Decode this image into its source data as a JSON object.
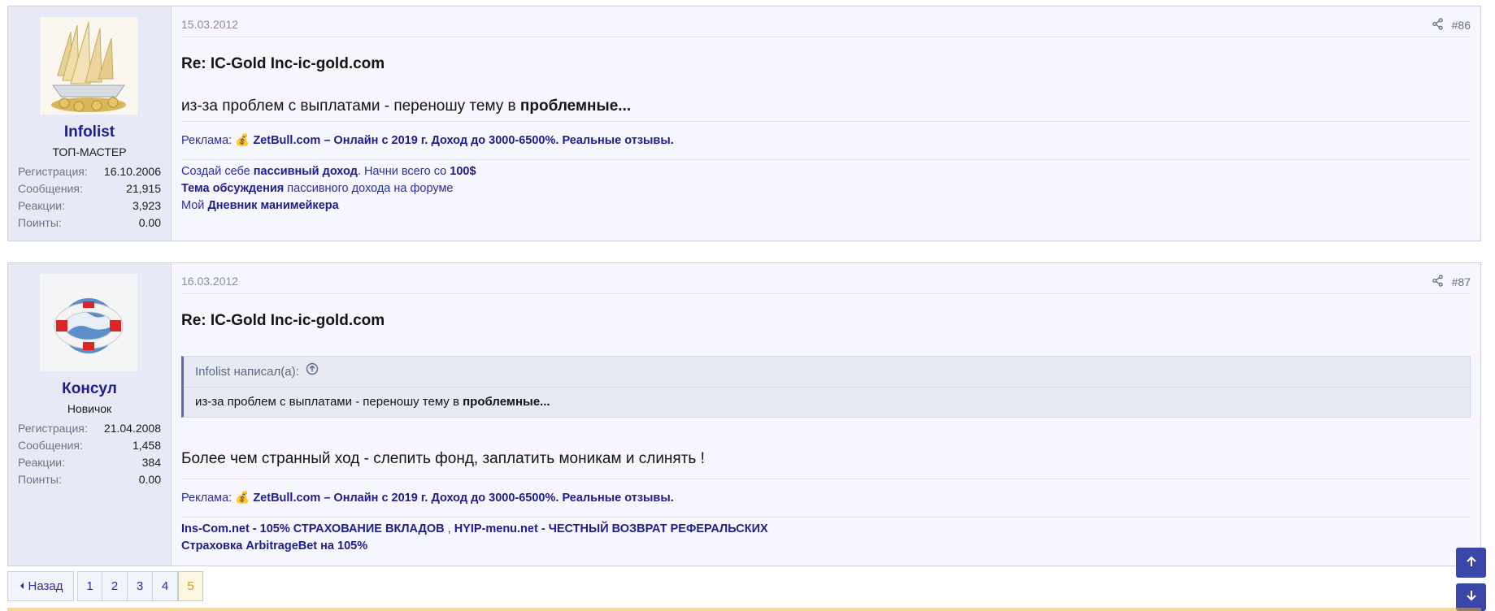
{
  "posts": [
    {
      "date": "15.03.2012",
      "number": "#86",
      "user": {
        "name": "Infolist",
        "title": "ТОП-МАСТЕР",
        "stats": [
          {
            "k": "Регистрация:",
            "v": "16.10.2006"
          },
          {
            "k": "Сообщения:",
            "v": "21,915"
          },
          {
            "k": "Реакции:",
            "v": "3,923"
          },
          {
            "k": "Поинты:",
            "v": "0.00"
          }
        ]
      },
      "title": "Re: IC-Gold Inc-ic-gold.com",
      "text_prefix": "из-за проблем с выплатами - переношу тему в ",
      "text_bold": "проблемные...",
      "ad_label": "Реклама: ",
      "ad_icon": "💰",
      "ad_text": "ZetBull.com – Онлайн с 2019 г. Доход до 3000-6500%. Реальные отзывы.",
      "sig": {
        "l1a": "Создай себе ",
        "l1b": "пассивный доход",
        "l1c": ". Начни всего со ",
        "l1d": "100$",
        "l2a": "Тема обсуждения",
        "l2b": " пассивного дохода на форуме",
        "l3a": "Мой ",
        "l3b": "Дневник манимейкера"
      }
    },
    {
      "date": "16.03.2012",
      "number": "#87",
      "user": {
        "name": "Консул",
        "title": "Новичок",
        "stats": [
          {
            "k": "Регистрация:",
            "v": "21.04.2008"
          },
          {
            "k": "Сообщения:",
            "v": "1,458"
          },
          {
            "k": "Реакции:",
            "v": "384"
          },
          {
            "k": "Поинты:",
            "v": "0.00"
          }
        ]
      },
      "title": "Re: IC-Gold Inc-ic-gold.com",
      "quote_author": "Infolist написал(а):",
      "quote_prefix": "из-за проблем с выплатами - переношу тему в ",
      "quote_bold": "проблемные...",
      "text": "Более чем странный ход - слепить фонд, заплатить моникам и слинять !",
      "ad_label": "Реклама: ",
      "ad_icon": "💰",
      "ad_text": "ZetBull.com – Онлайн с 2019 г. Доход до 3000-6500%. Реальные отзывы.",
      "sig": {
        "l1a": "Ins-Com.net - 105% СТРАХОВАНИЕ ВКЛАДОВ",
        "l1b": " , ",
        "l1c": "HYIP-menu.net - ЧЕСТНЫЙ ВОЗВРАТ РЕФЕРАЛЬСКИХ",
        "l2a": "Страховка ArbitrageBet на 105%"
      }
    }
  ],
  "pagination": {
    "back_label": "Назад",
    "pages": [
      "1",
      "2",
      "3",
      "4",
      "5"
    ],
    "current": "5"
  },
  "icons": {
    "share": "share-icon",
    "quote_up": "arrow-up-circle-icon",
    "scroll_top": "arrow-up-icon",
    "scroll_bottom": "arrow-down-icon",
    "back": "caret-left-icon"
  },
  "colors": {
    "link": "#1d1d8e",
    "accent": "#3b47a8",
    "current_page": "#d49a24"
  }
}
